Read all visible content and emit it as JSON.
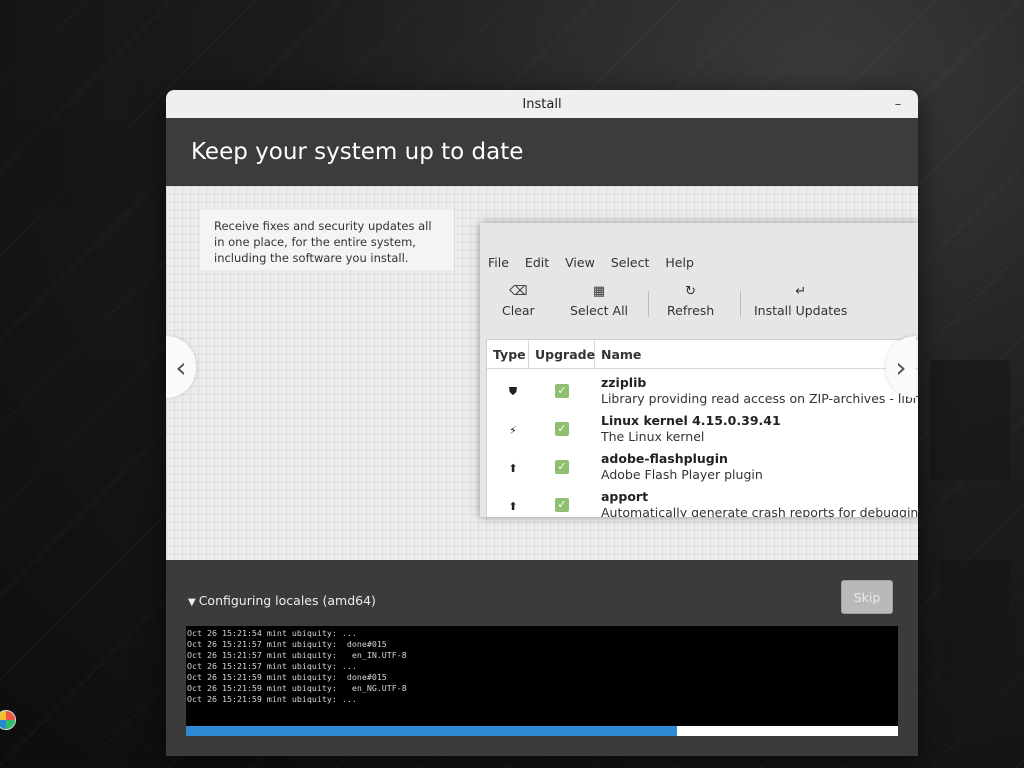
{
  "window": {
    "title": "Install",
    "minimize_glyph": "–"
  },
  "header": {
    "title": "Keep your system up to date"
  },
  "slide": {
    "description": "Receive fixes and security updates all in one place, for the entire system, including the software you install.",
    "nav_left_glyph": "‹",
    "nav_right_glyph": "›"
  },
  "app": {
    "menu": [
      "File",
      "Edit",
      "View",
      "Select",
      "Help"
    ],
    "toolbar": {
      "clear": {
        "label": "Clear",
        "icon": "backspace-icon",
        "glyph": "⌫"
      },
      "select_all": {
        "label": "Select All",
        "icon": "select-all-icon",
        "glyph": "▦"
      },
      "refresh": {
        "label": "Refresh",
        "icon": "refresh-icon",
        "glyph": "↻"
      },
      "install": {
        "label": "Install Updates",
        "icon": "install-icon",
        "glyph": "↵"
      }
    },
    "columns": {
      "type": "Type",
      "upgrade": "Upgrade",
      "name": "Name"
    },
    "rows": [
      {
        "type_icon": "shield-icon",
        "type_glyph": "⛊",
        "checked": "✓",
        "name": "zziplib",
        "desc": "Library providing read access on ZIP-archives - library"
      },
      {
        "type_icon": "kernel-bolt-icon",
        "type_glyph": "⚡",
        "checked": "✓",
        "name": "Linux kernel 4.15.0.39.41",
        "desc": "The Linux kernel"
      },
      {
        "type_icon": "upgrade-arrow-icon",
        "type_glyph": "⬆",
        "checked": "✓",
        "name": "adobe-flashplugin",
        "desc": "Adobe Flash Player plugin"
      },
      {
        "type_icon": "upgrade-arrow-icon",
        "type_glyph": "⬆",
        "checked": "✓",
        "name": "apport",
        "desc": "Automatically generate crash reports for debugging"
      }
    ]
  },
  "progress": {
    "status": "Configuring locales (amd64)",
    "skip_label": "Skip",
    "percent": 69,
    "log": [
      "Oct 26 15:21:54 mint ubiquity: ...",
      "Oct 26 15:21:57 mint ubiquity:  done#015",
      "Oct 26 15:21:57 mint ubiquity:   en_IN.UTF-8",
      "Oct 26 15:21:57 mint ubiquity: ...",
      "Oct 26 15:21:59 mint ubiquity:  done#015",
      "Oct 26 15:21:59 mint ubiquity:   en_NG.UTF-8",
      "Oct 26 15:21:59 mint ubiquity: ..."
    ]
  },
  "colors": {
    "accent": "#2f8ad3",
    "check": "#8fbf6f",
    "header_bg": "#3c3c3c"
  }
}
